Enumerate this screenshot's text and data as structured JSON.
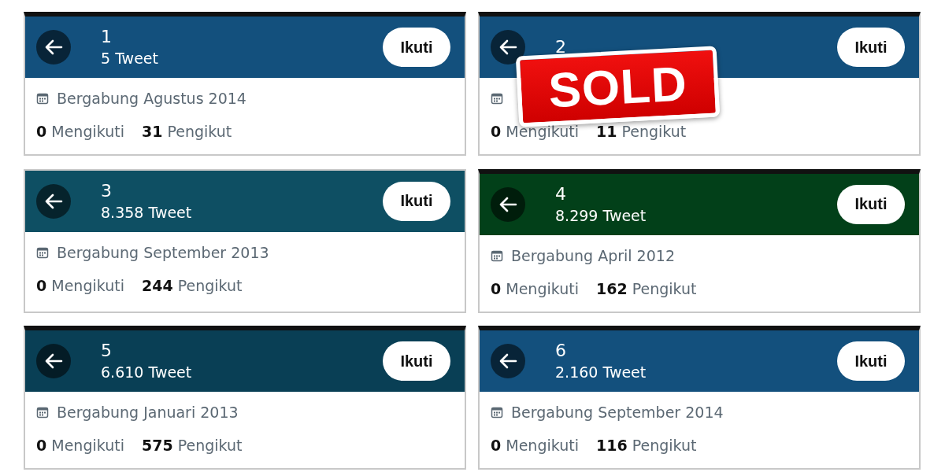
{
  "cards": [
    {
      "name": "1",
      "tweets": "5 Tweet",
      "button": "Ikuti",
      "color": "#13507d",
      "top_bar": true,
      "joined": "Bergabung Agustus 2014",
      "following_count": "0",
      "following_label": "Mengikuti",
      "followers_count": "31",
      "followers_label": "Pengikut"
    },
    {
      "name": "2",
      "button": "Ikuti",
      "color": "#13507d",
      "top_bar": true,
      "following_count": "0",
      "following_label": "Mengikuti",
      "followers_count": "11",
      "followers_label": "Pengikut",
      "sticker": "SOLD"
    },
    {
      "name": "3",
      "tweets": "8.358 Tweet",
      "button": "Ikuti",
      "color": "#0e4f63",
      "top_bar": false,
      "joined": "Bergabung September 2013",
      "following_count": "0",
      "following_label": "Mengikuti",
      "followers_count": "244",
      "followers_label": "Pengikut"
    },
    {
      "name": "4",
      "tweets": "8.299 Tweet",
      "button": "Ikuti",
      "color": "#024019",
      "top_bar": true,
      "joined": "Bergabung April 2012",
      "following_count": "0",
      "following_label": "Mengikuti",
      "followers_count": "162",
      "followers_label": "Pengikut"
    },
    {
      "name": "5",
      "tweets": "6.610 Tweet",
      "button": "Ikuti",
      "color": "#093f55",
      "top_bar": true,
      "joined": "Bergabung Januari 2013",
      "following_count": "0",
      "following_label": "Mengikuti",
      "followers_count": "575",
      "followers_label": "Pengikut"
    },
    {
      "name": "6",
      "tweets": "2.160 Tweet",
      "button": "Ikuti",
      "color": "#13507d",
      "top_bar": true,
      "joined": "Bergabung September 2014",
      "following_count": "0",
      "following_label": "Mengikuti",
      "followers_count": "116",
      "followers_label": "Pengikut"
    }
  ]
}
